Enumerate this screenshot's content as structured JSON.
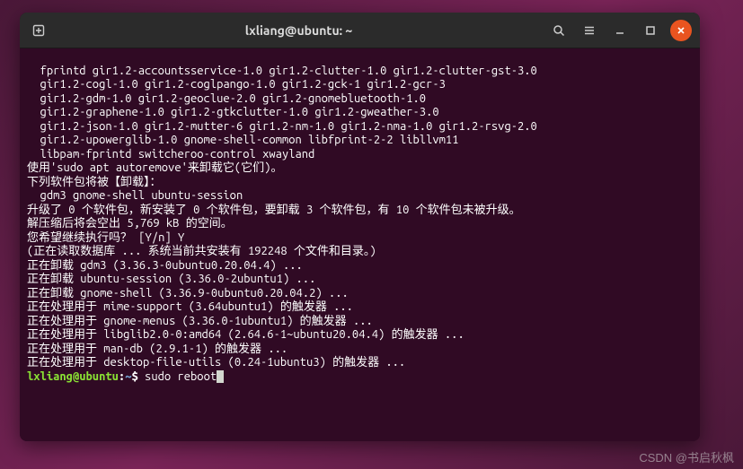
{
  "titlebar": {
    "title": "lxliang@ubuntu: ~"
  },
  "lines": [
    "  fprintd gir1.2-accountsservice-1.0 gir1.2-clutter-1.0 gir1.2-clutter-gst-3.0",
    "  gir1.2-cogl-1.0 gir1.2-coglpango-1.0 gir1.2-gck-1 gir1.2-gcr-3",
    "  gir1.2-gdm-1.0 gir1.2-geoclue-2.0 gir1.2-gnomebluetooth-1.0",
    "  gir1.2-graphene-1.0 gir1.2-gtkclutter-1.0 gir1.2-gweather-3.0",
    "  gir1.2-json-1.0 gir1.2-mutter-6 gir1.2-nm-1.0 gir1.2-nma-1.0 gir1.2-rsvg-2.0",
    "  gir1.2-upowerglib-1.0 gnome-shell-common libfprint-2-2 libllvm11",
    "  libpam-fprintd switcheroo-control xwayland",
    "使用'sudo apt autoremove'来卸载它(它们)。",
    "下列软件包将被【卸载】：",
    "  gdm3 gnome-shell ubuntu-session",
    "升级了 0 个软件包，新安装了 0 个软件包，要卸载 3 个软件包，有 10 个软件包未被升级。",
    "解压缩后将会空出 5,769 kB 的空间。",
    "您希望继续执行吗？ [Y/n] Y",
    "(正在读取数据库 ... 系统当前共安装有 192248 个文件和目录。)",
    "正在卸载 gdm3 (3.36.3-0ubuntu0.20.04.4) ...",
    "正在卸载 ubuntu-session (3.36.0-2ubuntu1) ...",
    "正在卸载 gnome-shell (3.36.9-0ubuntu0.20.04.2) ...",
    "正在处理用于 mime-support (3.64ubuntu1) 的触发器 ...",
    "正在处理用于 gnome-menus (3.36.0-1ubuntu1) 的触发器 ...",
    "正在处理用于 libglib2.0-0:amd64 (2.64.6-1~ubuntu20.04.4) 的触发器 ...",
    "正在处理用于 man-db (2.9.1-1) 的触发器 ...",
    "正在处理用于 desktop-file-utils (0.24-1ubuntu3) 的触发器 ..."
  ],
  "prompt": {
    "user_host": "lxliang@ubuntu",
    "colon": ":",
    "path": "~",
    "dollar": "$ ",
    "command": "sudo reboot"
  },
  "watermark": "CSDN @书启秋枫"
}
